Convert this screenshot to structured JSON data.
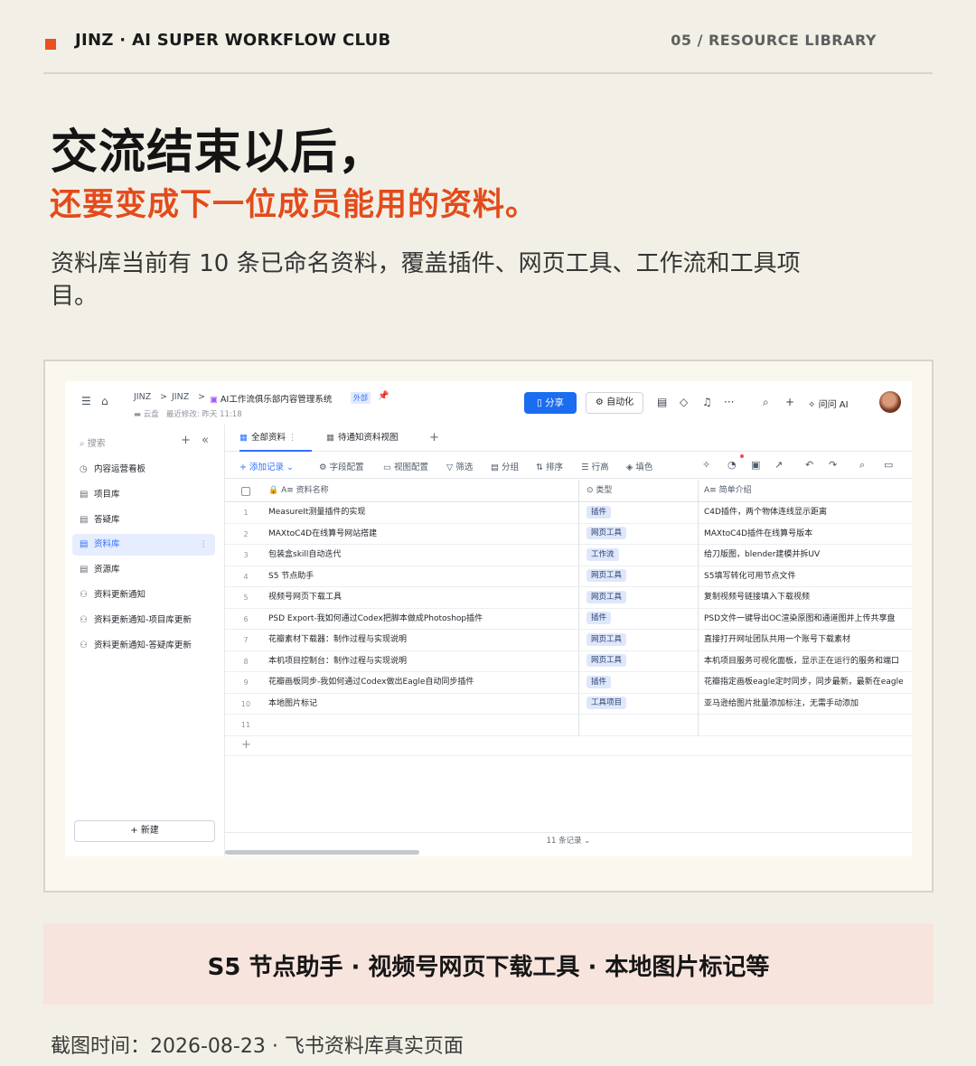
{
  "slide": {
    "brand": "JINZ · AI SUPER WORKFLOW CLUB",
    "section": "05 / RESOURCE LIBRARY",
    "headline": "交流结束以后，",
    "subheadline": "还要变成下一位成员能用的资料。",
    "description": "资料库当前有 10 条已命名资料，覆盖插件、网页工具、工作流和工具项目。",
    "highlight": "S5 节点助手 · 视频号网页下载工具 · 本地图片标记等",
    "caption": "截图时间：2026-08-23 · 飞书资料库真实页面",
    "colors": {
      "accent": "#e34b1b",
      "background": "#f2efe6",
      "highlight_bg": "#f7e4dd"
    }
  },
  "app": {
    "breadcrumb": {
      "root": "JINZ",
      "sep": ">",
      "folder": "JINZ",
      "title": "AI工作流俱乐部内容管理系统",
      "badge": "外部",
      "location": "云盘",
      "modified": "最近修改: 昨天 11:18"
    },
    "header": {
      "share": "分享",
      "automation": "自动化",
      "ask_ai": "问问 AI"
    },
    "sidebar": {
      "search_placeholder": "搜索",
      "items": [
        {
          "icon": "dashboard-icon",
          "label": "内容运营看板"
        },
        {
          "icon": "table-icon",
          "label": "项目库"
        },
        {
          "icon": "table-icon",
          "label": "答疑库"
        },
        {
          "icon": "table-icon",
          "label": "资料库"
        },
        {
          "icon": "table-icon",
          "label": "资源库"
        },
        {
          "icon": "workflow-icon",
          "label": "资料更新通知"
        },
        {
          "icon": "workflow-icon",
          "label": "资料更新通知-项目库更新"
        },
        {
          "icon": "workflow-icon",
          "label": "资料更新通知-答疑库更新"
        }
      ],
      "active_item": "资料库",
      "new_button": "新建"
    },
    "view_tabs": [
      "全部资料",
      "待通知资料视图"
    ],
    "toolbar": {
      "add_record": "添加记录",
      "field_config": "字段配置",
      "view_config": "视图配置",
      "filter": "筛选",
      "group": "分组",
      "sort": "排序",
      "row_height": "行高",
      "fill_color": "填色"
    },
    "table": {
      "columns": [
        "资料名称",
        "类型",
        "简单介绍"
      ],
      "rows": [
        {
          "num": "1",
          "name": "MeasureIt测量插件的实现",
          "type": "插件",
          "desc": "C4D插件，两个物体连线显示距离"
        },
        {
          "num": "2",
          "name": "MAXtoC4D在线算号网站搭建",
          "type": "网页工具",
          "desc": "MAXtoC4D插件在线算号版本"
        },
        {
          "num": "3",
          "name": "包装盒skill自动迭代",
          "type": "工作流",
          "desc": "给刀版图，blender建模并拆UV"
        },
        {
          "num": "4",
          "name": "S5 节点助手",
          "type": "网页工具",
          "desc": "S5填写转化可用节点文件"
        },
        {
          "num": "5",
          "name": "视频号网页下载工具",
          "type": "网页工具",
          "desc": "复制视频号链接填入下载视频"
        },
        {
          "num": "6",
          "name": "PSD Export-我如何通过Codex把脚本做成Photoshop插件",
          "type": "插件",
          "desc": "PSD文件一键导出OC渲染原图和通道图并上传共享盘"
        },
        {
          "num": "7",
          "name": "花瓣素材下载器：制作过程与实现说明",
          "type": "网页工具",
          "desc": "直接打开网址团队共用一个账号下载素材"
        },
        {
          "num": "8",
          "name": "本机项目控制台：制作过程与实现说明",
          "type": "网页工具",
          "desc": "本机项目服务可视化面板，显示正在运行的服务和端口"
        },
        {
          "num": "9",
          "name": "花瓣画板同步-我如何通过Codex做出Eagle自动同步插件",
          "type": "插件",
          "desc": "花瓣指定画板eagle定时同步，同步最新，最新在eagle"
        },
        {
          "num": "10",
          "name": "本地图片标记",
          "type": "工具项目",
          "desc": "亚马逊给图片批量添加标注，无需手动添加"
        },
        {
          "num": "11",
          "name": "",
          "type": "",
          "desc": ""
        }
      ],
      "add_row": "+",
      "record_count": "11 条记录"
    }
  }
}
